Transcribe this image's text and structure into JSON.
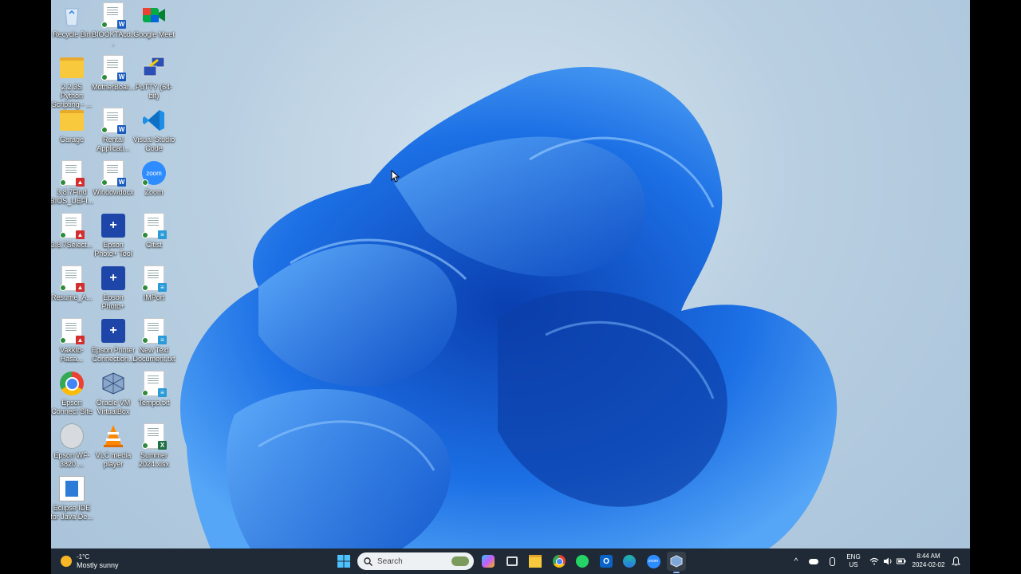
{
  "desktop": {
    "icons": [
      {
        "label": "Recycle Bin"
      },
      {
        "label": "BIOOKTAcd..."
      },
      {
        "label": "Google Meet"
      },
      {
        "label": "2.2.3S Python Scripting - ..."
      },
      {
        "label": "MotherBoar..."
      },
      {
        "label": "PuTTY (64-bit)"
      },
      {
        "label": "Garage"
      },
      {
        "label": "Rental Applicati..."
      },
      {
        "label": "Visual Studio Code"
      },
      {
        "label": "3.8.7Find BIOS_UEFI..."
      },
      {
        "label": "Windowdocx"
      },
      {
        "label": "Zoom"
      },
      {
        "label": "3.8.7Select..."
      },
      {
        "label": "Epson Photo+ Tool"
      },
      {
        "label": "Citist"
      },
      {
        "label": "Resume_A..."
      },
      {
        "label": "Epson Photo+"
      },
      {
        "label": "IMPort"
      },
      {
        "label": "VakkIb-Hasa..."
      },
      {
        "label": "Epson Printer Connection..."
      },
      {
        "label": "New Text Document.txt"
      },
      {
        "label": "Epson Connect Site"
      },
      {
        "label": "Oracle VM VirtualBox"
      },
      {
        "label": "Tempo.txt"
      },
      {
        "label": "Epson WF-3820 ..."
      },
      {
        "label": "VLC media player"
      },
      {
        "label": "Summer 2024.xlsx"
      },
      {
        "label": "Eclipse IDE for Java De..."
      }
    ]
  },
  "taskbar": {
    "weather_temp": "-1°C",
    "weather_desc": "Mostly sunny",
    "search_placeholder": "Search",
    "lang": "ENG",
    "region": "US",
    "time": "8:44 AM",
    "date": "2024-02-02",
    "zoom_logo": "zoom"
  },
  "icon_names": [
    "recycle-bin-icon",
    "word-doc-icon",
    "google-meet-icon",
    "folder-icon",
    "putty-icon",
    "vscode-icon",
    "pdf-doc-icon",
    "zoom-icon",
    "epson-icon",
    "text-doc-icon",
    "chrome-icon",
    "virtualbox-icon",
    "vlc-icon",
    "excel-icon",
    "eclipse-icon"
  ],
  "colors": {
    "taskbar": "#1f2a36",
    "accent": "#0067c0",
    "bloom": "#1a6fe0"
  }
}
